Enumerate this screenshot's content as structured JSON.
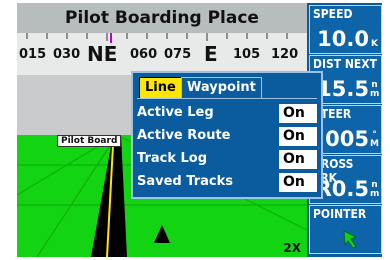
{
  "view": {
    "title": "Pilot Boarding Place",
    "compass": [
      "015",
      "030",
      "NE",
      "060",
      "075",
      "E",
      "105",
      "120"
    ],
    "waypoint_label": "Pilot Board",
    "zoom": "2X"
  },
  "options": {
    "tabs": [
      {
        "label": "Line",
        "active": true
      },
      {
        "label": "Waypoint",
        "active": false
      }
    ],
    "rows": [
      {
        "label": "Active Leg",
        "value": "On"
      },
      {
        "label": "Active Route",
        "value": "On"
      },
      {
        "label": "Track Log",
        "value": "On"
      },
      {
        "label": "Saved Tracks",
        "value": "On"
      }
    ]
  },
  "fields": [
    {
      "label": "SPEED",
      "value": "10.0",
      "unit": "K"
    },
    {
      "label": "DIST NEXT",
      "value": "15.5",
      "unit": "n m"
    },
    {
      "label": "STEER",
      "value": "005",
      "unit": "° M"
    },
    {
      "label": "CROSS TRK",
      "value": "R0.5",
      "unit": "n m"
    },
    {
      "label": "POINTER",
      "value": "",
      "unit": ""
    }
  ],
  "colors": {
    "ground": "#13d413",
    "panel": "#0b5c9e",
    "active_tab": "#ffe600"
  }
}
